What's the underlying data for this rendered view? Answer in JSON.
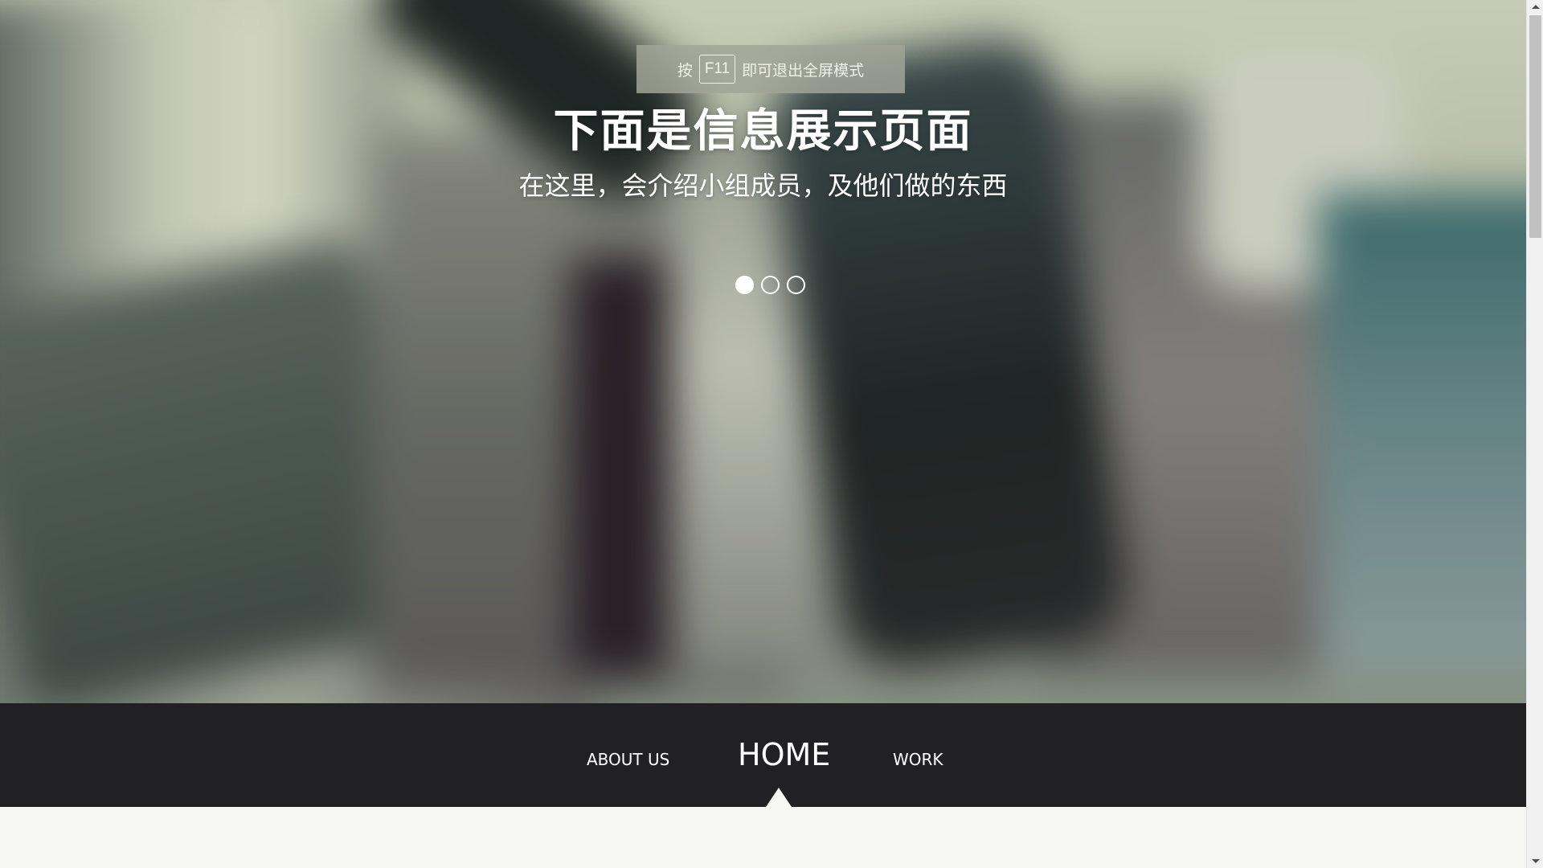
{
  "fullscreen_notice": {
    "prefix": "按",
    "key": "F11",
    "suffix": "即可退出全屏模式"
  },
  "hero": {
    "title": "下面是信息展示页面",
    "subtitle": "在这里，会介绍小组成员，及他们做的东西",
    "slide_count": 3,
    "active_slide": 1
  },
  "nav": {
    "about": "ABOUT US",
    "home": "HOME",
    "work": "WORK",
    "active": "HOME"
  },
  "colors": {
    "navbar_bg": "#212123",
    "content_bg": "#f6f6f3",
    "text": "#ffffff"
  }
}
